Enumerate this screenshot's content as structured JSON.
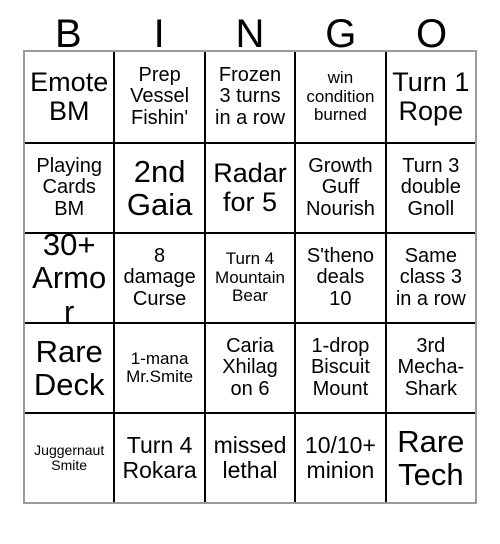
{
  "card": {
    "title": "BINGO",
    "header_letters": [
      "B",
      "I",
      "N",
      "G",
      "O"
    ],
    "colors": {
      "text": "#000000",
      "cell_background": "#ffffff",
      "grid_line": "#000000",
      "outer_border": "#9a9a9a",
      "page_background": "#ffffff"
    },
    "rows": [
      [
        {
          "text": "Emote\nBM",
          "size": "lg"
        },
        {
          "text": "Prep\nVessel\nFishin'",
          "size": "sm"
        },
        {
          "text": "Frozen\n3 turns\nin a row",
          "size": "sm"
        },
        {
          "text": "win\ncondition\nburned",
          "size": "xs"
        },
        {
          "text": "Turn 1\nRope",
          "size": "lg"
        }
      ],
      [
        {
          "text": "Playing\nCards\nBM",
          "size": "sm"
        },
        {
          "text": "2nd\nGaia",
          "size": "xl"
        },
        {
          "text": "Radar\nfor 5",
          "size": "lg"
        },
        {
          "text": "Growth\nGuff\nNourish",
          "size": "sm"
        },
        {
          "text": "Turn 3\ndouble\nGnoll",
          "size": "sm"
        }
      ],
      [
        {
          "text": "30+\nArmor",
          "size": "xl"
        },
        {
          "text": "8\ndamage\nCurse",
          "size": "sm"
        },
        {
          "text": "Turn 4\nMountain\nBear",
          "size": "xs"
        },
        {
          "text": "S'theno\ndeals\n10",
          "size": "sm"
        },
        {
          "text": "Same\nclass 3\nin a row",
          "size": "sm"
        }
      ],
      [
        {
          "text": "Rare\nDeck",
          "size": "xl"
        },
        {
          "text": "1-mana\nMr.Smite",
          "size": "xs"
        },
        {
          "text": "Caria\nXhilag\non 6",
          "size": "sm"
        },
        {
          "text": "1-drop\nBiscuit\nMount",
          "size": "sm"
        },
        {
          "text": "3rd\nMecha-\nShark",
          "size": "sm"
        }
      ],
      [
        {
          "text": "Juggernaut\nSmite",
          "size": "xxs"
        },
        {
          "text": "Turn 4\nRokara",
          "size": "md"
        },
        {
          "text": "missed\nlethal",
          "size": "md"
        },
        {
          "text": "10/10+\nminion",
          "size": "md"
        },
        {
          "text": "Rare\nTech",
          "size": "xl"
        }
      ]
    ]
  }
}
